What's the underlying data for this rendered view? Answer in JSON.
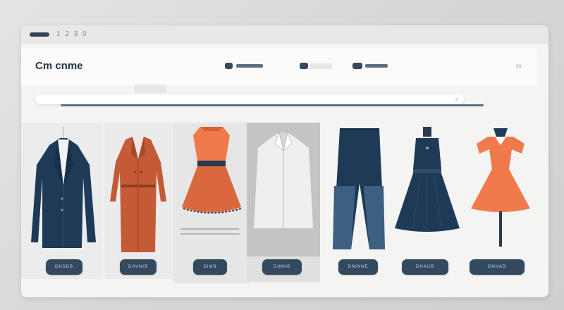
{
  "titlebar": {
    "text": "1 2 3 0"
  },
  "header": {
    "logo": "Cm cnme",
    "right_text": "lllt"
  },
  "products": [
    {
      "name": "navy-blazer",
      "button": "DNSDB"
    },
    {
      "name": "rust-coat",
      "button": "DAVNIB"
    },
    {
      "name": "orange-skirt-dress",
      "button": "DIMB"
    },
    {
      "name": "grey-shirt",
      "button": "DIMNB"
    },
    {
      "name": "navy-trousers",
      "button": "DNINNE"
    },
    {
      "name": "navy-dress",
      "button": "DNAUB"
    },
    {
      "name": "orange-dress",
      "button": "DNNAB"
    }
  ],
  "colors": {
    "navy": "#1f3a57",
    "rust": "#c45a36",
    "orange": "#f07a4b",
    "grey_shirt": "#d9d9d9",
    "button": "#33495e"
  }
}
